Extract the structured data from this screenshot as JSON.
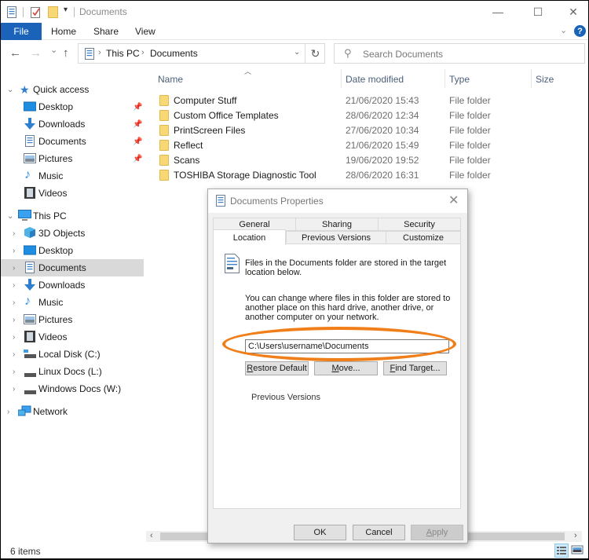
{
  "window": {
    "title": "Documents",
    "controls": {
      "minimize": "—",
      "maximize": "☐",
      "close": "✕"
    }
  },
  "ribbon": {
    "tabs": [
      "File",
      "Home",
      "Share",
      "View"
    ],
    "help": "?"
  },
  "nav": {
    "back": "←",
    "forward": "→",
    "recent": "⌄",
    "up": "↑",
    "breadcrumb": [
      "This PC",
      "Documents"
    ],
    "refresh": "↻",
    "search_placeholder": "Search Documents"
  },
  "sidebar": {
    "quick_access": {
      "label": "Quick access",
      "items": [
        {
          "label": "Desktop",
          "icon": "desktop-icon",
          "pinned": true
        },
        {
          "label": "Downloads",
          "icon": "downloads-icon",
          "pinned": true
        },
        {
          "label": "Documents",
          "icon": "documents-icon",
          "pinned": true
        },
        {
          "label": "Pictures",
          "icon": "pictures-icon",
          "pinned": true
        },
        {
          "label": "Music",
          "icon": "music-icon",
          "pinned": false
        },
        {
          "label": "Videos",
          "icon": "videos-icon",
          "pinned": false
        }
      ]
    },
    "this_pc": {
      "label": "This PC",
      "items": [
        {
          "label": "3D Objects",
          "icon": "3d-objects-icon"
        },
        {
          "label": "Desktop",
          "icon": "desktop-icon"
        },
        {
          "label": "Documents",
          "icon": "documents-icon",
          "selected": true
        },
        {
          "label": "Downloads",
          "icon": "downloads-icon"
        },
        {
          "label": "Music",
          "icon": "music-icon"
        },
        {
          "label": "Pictures",
          "icon": "pictures-icon"
        },
        {
          "label": "Videos",
          "icon": "videos-icon"
        },
        {
          "label": "Local Disk (C:)",
          "icon": "local-disk-icon"
        },
        {
          "label": "Linux Docs (L:)",
          "icon": "drive-icon"
        },
        {
          "label": "Windows Docs (W:)",
          "icon": "drive-icon"
        }
      ]
    },
    "network": {
      "label": "Network"
    }
  },
  "filelist": {
    "columns": [
      "Name",
      "Date modified",
      "Type",
      "Size"
    ],
    "rows": [
      {
        "name": "Computer Stuff",
        "date": "21/06/2020 15:43",
        "type": "File folder"
      },
      {
        "name": "Custom Office Templates",
        "date": "28/06/2020 12:34",
        "type": "File folder"
      },
      {
        "name": "PrintScreen Files",
        "date": "27/06/2020 10:34",
        "type": "File folder"
      },
      {
        "name": "Reflect",
        "date": "21/06/2020 15:49",
        "type": "File folder"
      },
      {
        "name": "Scans",
        "date": "19/06/2020 19:52",
        "type": "File folder"
      },
      {
        "name": "TOSHIBA Storage Diagnostic Tool",
        "date": "28/06/2020 16:31",
        "type": "File folder"
      }
    ]
  },
  "status": {
    "item_count": "6 items"
  },
  "dialog": {
    "title": "Documents Properties",
    "tabs_back": [
      "General",
      "Sharing",
      "Security"
    ],
    "tabs_front": [
      "Location",
      "Previous Versions",
      "Customize"
    ],
    "active_tab": "Location",
    "info_text": "Files in the Documents folder are stored in the target location below.",
    "change_text": "You can change where files in this folder are stored to another place on this hard drive, another drive, or another computer on your network.",
    "path_value": "C:\\Users\\username\\Documents",
    "buttons": {
      "restore_default": {
        "accel": "R",
        "rest": "estore Default"
      },
      "move": {
        "accel": "M",
        "rest": "ove..."
      },
      "find_target": {
        "accel": "F",
        "rest": "ind Target..."
      }
    },
    "previous_versions_label": "Previous Versions",
    "footer": {
      "ok": "OK",
      "cancel": "Cancel",
      "apply_accel": "A",
      "apply_rest": "pply"
    },
    "highlight_color": "#f07f1a"
  },
  "colors": {
    "accent": "#1a63b8",
    "selected_bg": "#d9d9d9",
    "folder": "#f8d775"
  }
}
